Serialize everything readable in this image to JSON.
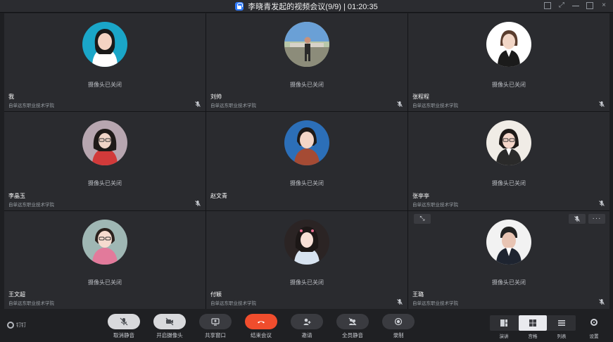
{
  "window": {
    "title": "李晓青发起的视频会议(9/9) | 01:20:35"
  },
  "participants": [
    {
      "name": "我",
      "org": "自单远东职业技术学院",
      "status": "摄像头已关闭",
      "avatar": "photo-woman-long-hair-teal-bg"
    },
    {
      "name": "刘帅",
      "org": "自单远东职业技术学院",
      "status": "摄像头已关闭",
      "avatar": "photo-man-outdoor"
    },
    {
      "name": "张程程",
      "org": "自单远东职业技术学院",
      "status": "摄像头已关闭",
      "avatar": "photo-woman-white-bg"
    },
    {
      "name": "李晶玉",
      "org": "自单远东职业技术学院",
      "status": "摄像头已关闭",
      "avatar": "photo-woman-glasses"
    },
    {
      "name": "赵文青",
      "org": "",
      "status": "摄像头已关闭",
      "avatar": "photo-woman-blue-bg"
    },
    {
      "name": "张亭亭",
      "org": "自单远东职业技术学院",
      "status": "摄像头已关闭",
      "avatar": "photo-woman-glasses-white"
    },
    {
      "name": "王文超",
      "org": "自单远东职业技术学院",
      "status": "摄像头已关闭",
      "avatar": "photo-woman-pink"
    },
    {
      "name": "付颖",
      "org": "自单远东职业技术学院",
      "status": "摄像头已关闭",
      "avatar": "photo-woman-filter"
    },
    {
      "name": "王璐",
      "org": "自单远东职业技术学院",
      "status": "摄像头已关闭",
      "avatar": "photo-man-suit"
    }
  ],
  "toolbar": {
    "brand": "钉钉",
    "buttons": [
      {
        "label": "取消静音"
      },
      {
        "label": "开启摄像头"
      },
      {
        "label": "共享窗口"
      },
      {
        "label": "结束会议"
      },
      {
        "label": "邀请"
      },
      {
        "label": "全员静音"
      },
      {
        "label": "录制"
      }
    ],
    "views": [
      {
        "label": "演讲"
      },
      {
        "label": "宫格"
      },
      {
        "label": "列表"
      }
    ],
    "settings_label": "设置"
  },
  "colors": {
    "end_call": "#f04d2d",
    "accent": "#2f7bff",
    "tile_bg": "#2a2b2f"
  }
}
